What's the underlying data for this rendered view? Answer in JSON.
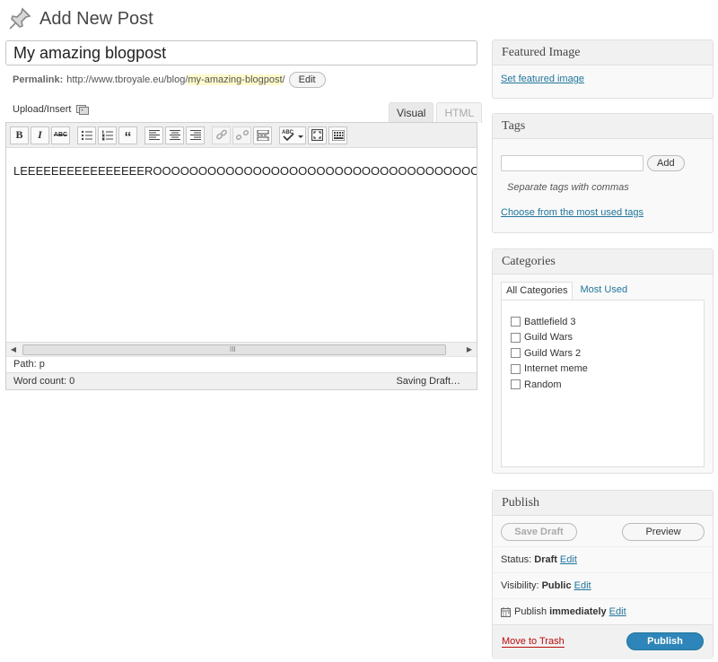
{
  "header": {
    "title": "Add New Post"
  },
  "post": {
    "title_value": "My amazing blogpost",
    "permalink_label": "Permalink:",
    "permalink_base": "http://www.tbroyale.eu/blog/",
    "permalink_slug": "my-amazing-blogpost",
    "permalink_end": "/",
    "edit_label": "Edit"
  },
  "editor": {
    "upload_label": "Upload/Insert",
    "tabs": [
      {
        "label": "Visual"
      },
      {
        "label": "HTML"
      }
    ],
    "toolbar": {
      "bold": "B",
      "italic": "I",
      "strike": "ABC",
      "quote": "“"
    },
    "content": "LEEEEEEEEEEEEEEEEROOOOOOOOOOOOOOOOOOOOOOOOOOOOOOOOOOOOY...",
    "path_label": "Path:",
    "path_value": "p",
    "word_count": "Word count: 0",
    "saving": "Saving Draft…",
    "scroll_grip": "III"
  },
  "featured": {
    "title": "Featured Image",
    "link": "Set featured image"
  },
  "tags": {
    "title": "Tags",
    "add_label": "Add",
    "hint": "Separate tags with commas",
    "choose_link": "Choose from the most used tags"
  },
  "categories": {
    "title": "Categories",
    "tab_all": "All Categories",
    "tab_most": "Most Used",
    "items": [
      {
        "label": "Battlefield 3"
      },
      {
        "label": "Guild Wars"
      },
      {
        "label": "Guild Wars 2"
      },
      {
        "label": "Internet meme"
      },
      {
        "label": "Random"
      }
    ]
  },
  "publish": {
    "title": "Publish",
    "save_draft": "Save Draft",
    "preview": "Preview",
    "status_label": "Status:",
    "status_value": "Draft",
    "visibility_label": "Visibility:",
    "visibility_value": "Public",
    "schedule_label": "Publish",
    "schedule_value": "immediately",
    "edit_label": "Edit",
    "trash": "Move to Trash",
    "publish_button": "Publish"
  },
  "colors": {
    "accent": "#21759b",
    "publish": "#2e85b9",
    "trash": "#bc0b0b"
  }
}
